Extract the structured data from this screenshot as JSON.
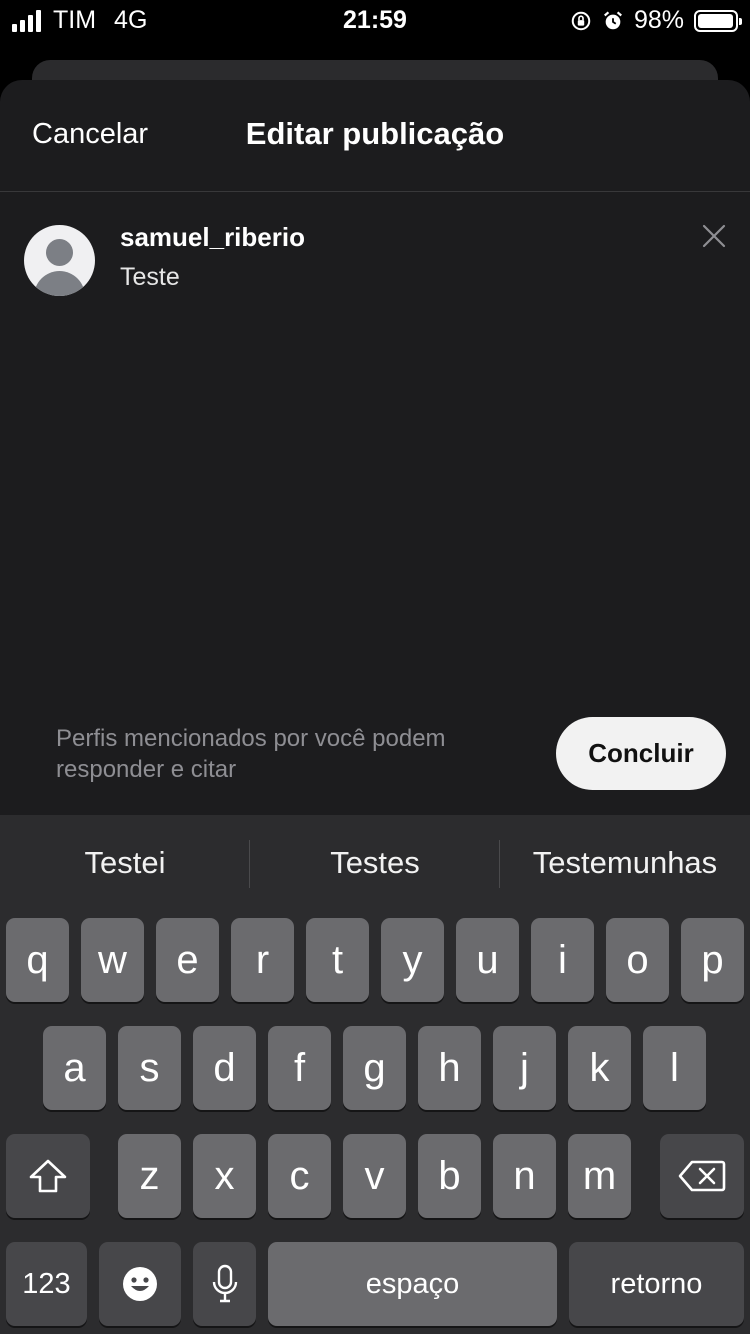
{
  "status_bar": {
    "carrier": "TIM",
    "network": "4G",
    "time": "21:59",
    "battery": "98%",
    "battery_level": 0.98,
    "icons": [
      "signal-icon",
      "rotation-lock-icon",
      "alarm-icon",
      "battery-icon"
    ]
  },
  "header": {
    "cancel_label": "Cancelar",
    "title": "Editar publicação"
  },
  "post": {
    "username": "samuel_riberio",
    "text": "Teste",
    "close_icon": "close-icon"
  },
  "footer": {
    "mention_note": "Perfis mencionados por você podem responder e citar",
    "done_label": "Concluir"
  },
  "keyboard": {
    "suggestions": [
      "Testei",
      "Testes",
      "Testemunhas"
    ],
    "row1": [
      "q",
      "w",
      "e",
      "r",
      "t",
      "y",
      "u",
      "i",
      "o",
      "p"
    ],
    "row2": [
      "a",
      "s",
      "d",
      "f",
      "g",
      "h",
      "j",
      "k",
      "l"
    ],
    "row3": [
      "z",
      "x",
      "c",
      "v",
      "b",
      "n",
      "m"
    ],
    "numbers_label": "123",
    "space_label": "espaço",
    "return_label": "retorno",
    "icons": [
      "shift-icon",
      "backspace-icon",
      "emoji-icon",
      "microphone-icon"
    ]
  },
  "colors": {
    "sheet_bg": "#1c1c1e",
    "keyboard_bg": "#2c2c2e",
    "key_bg": "#6b6b6e",
    "fn_key_bg": "#47474a",
    "done_button_bg": "#f2f2f2"
  }
}
